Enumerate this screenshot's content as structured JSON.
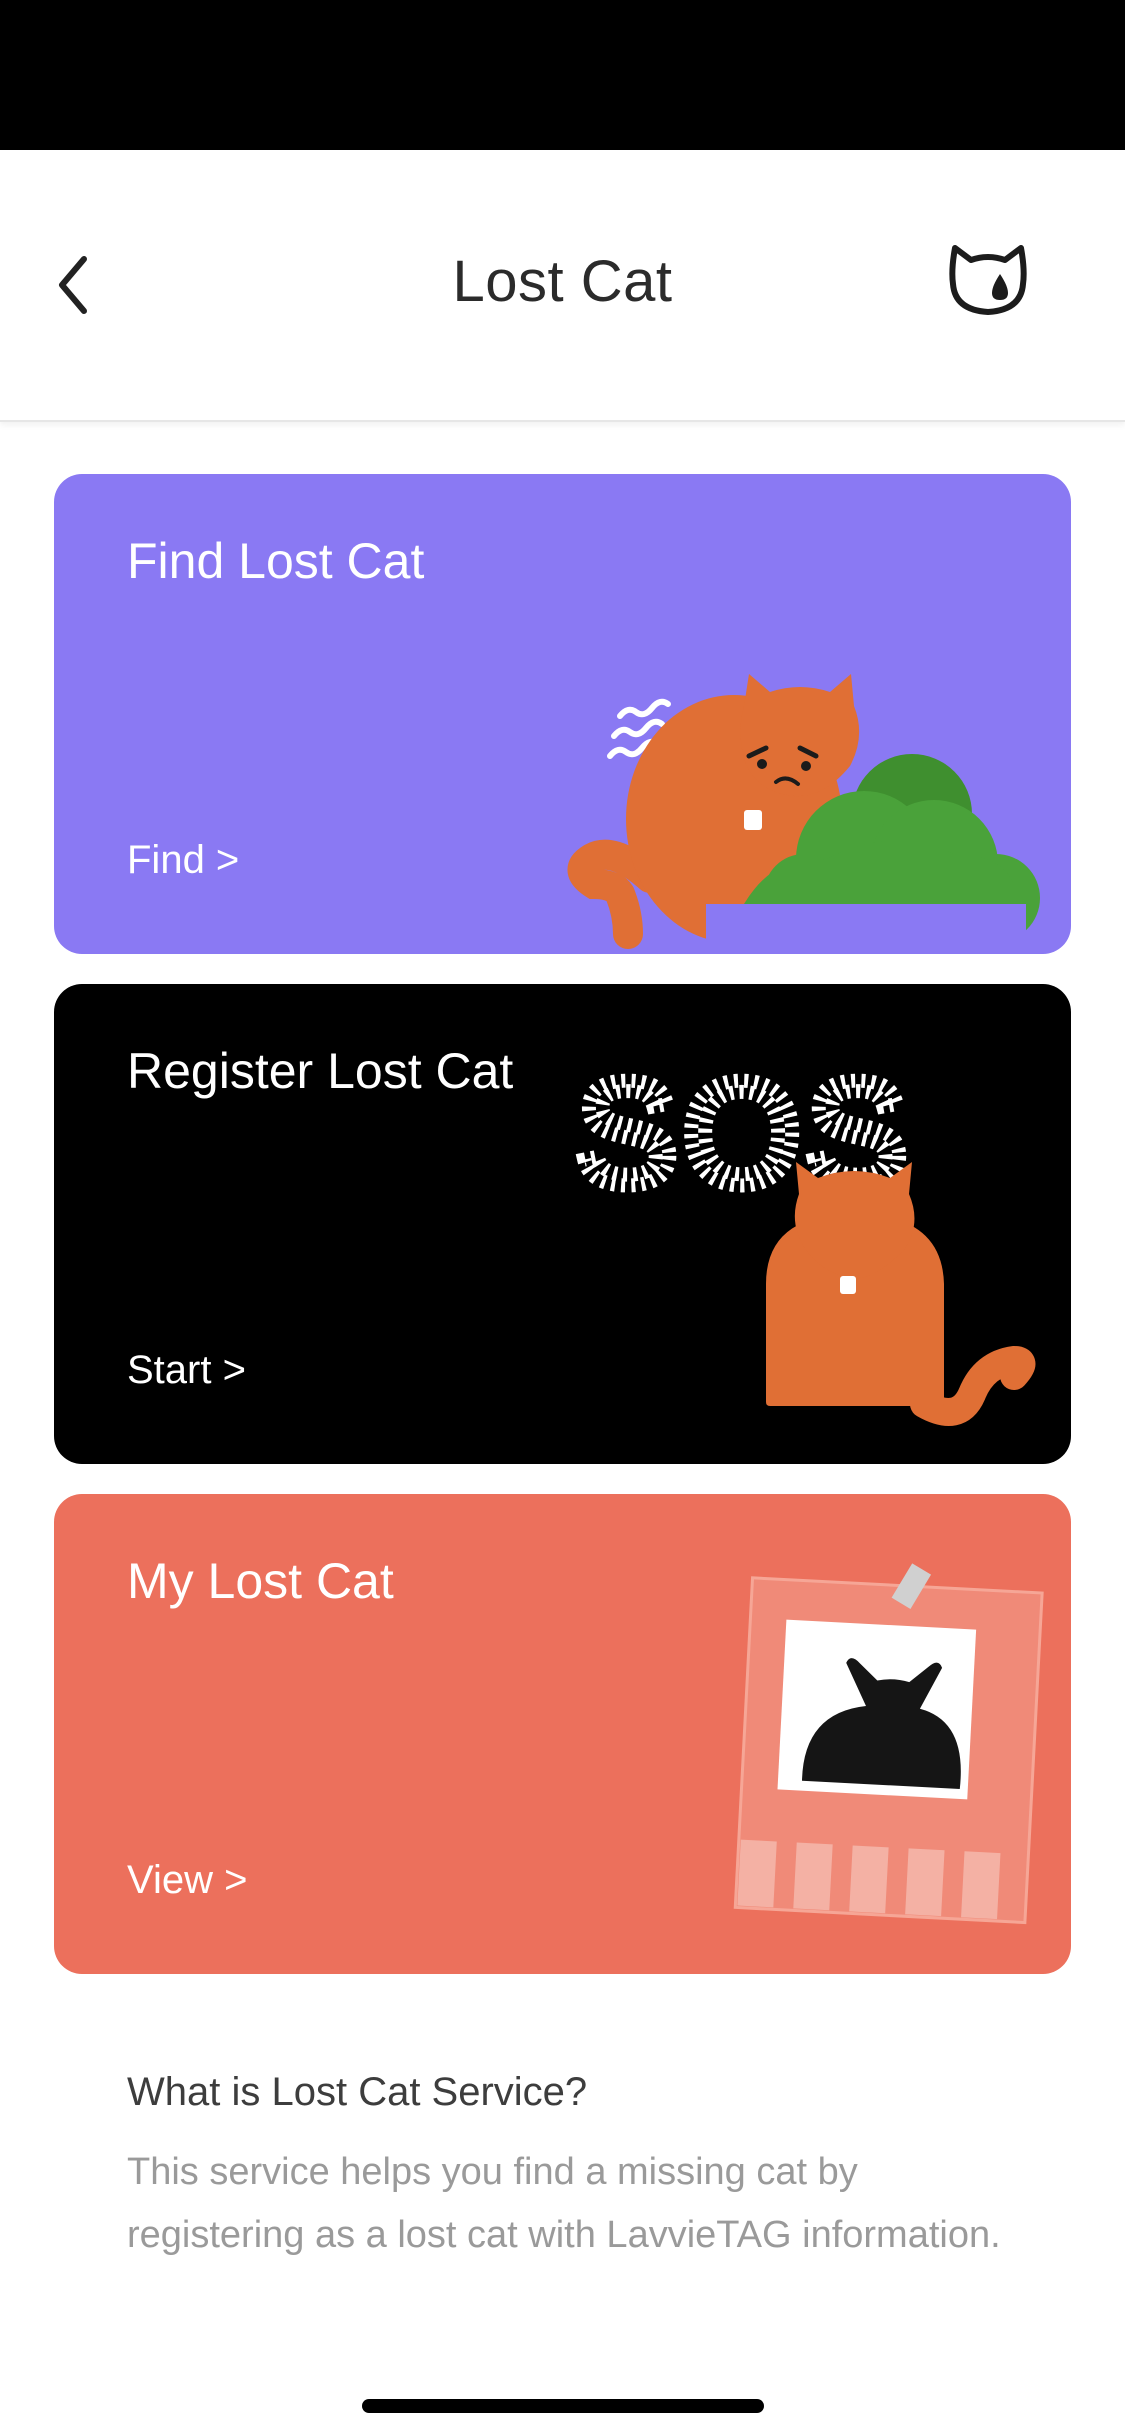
{
  "header": {
    "title": "Lost Cat",
    "back_icon": "chevron-left-icon",
    "right_icon": "cat-face-teardrop-icon"
  },
  "cards": [
    {
      "title": "Find Lost Cat",
      "action": "Find >",
      "background": "#8a79f3"
    },
    {
      "title": "Register Lost Cat",
      "action": "Start >",
      "background": "#000000",
      "art_text": "SOS"
    },
    {
      "title": "My Lost Cat",
      "action": "View >",
      "background": "#ec705c"
    }
  ],
  "info": {
    "title": "What is Lost Cat Service?",
    "body": "This service helps you find a missing cat by registering as a lost cat with LavvieTAG information."
  },
  "colors": {
    "cat_orange": "#e06f35",
    "bush_green": "#4aa23a",
    "text_dark": "#2b2b2b",
    "text_muted": "#9a9a9a"
  }
}
